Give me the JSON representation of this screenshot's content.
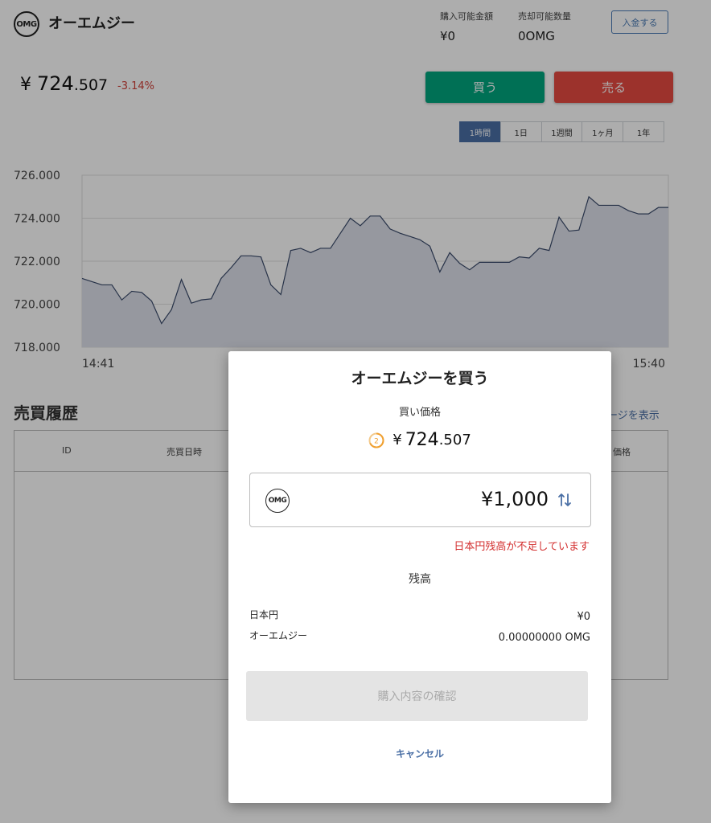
{
  "header": {
    "coin_logo_text": "OMG",
    "coin_name": "オーエムジー",
    "buyable_label": "購入可能金額",
    "buyable_value": "¥0",
    "sellable_label": "売却可能数量",
    "sellable_value": "0OMG",
    "deposit_label": "入金する"
  },
  "price": {
    "currency": "¥",
    "integer": "724",
    "decimal": ".507",
    "change": "-3.14%"
  },
  "actions": {
    "buy_label": "買う",
    "sell_label": "売る"
  },
  "range_tabs": [
    {
      "label": "1時間",
      "active": true
    },
    {
      "label": "1日",
      "active": false
    },
    {
      "label": "1週間",
      "active": false
    },
    {
      "label": "1ヶ月",
      "active": false
    },
    {
      "label": "1年",
      "active": false
    }
  ],
  "chart_data": {
    "type": "area",
    "x_start_label": "14:41",
    "x_end_label": "15:40",
    "y_ticks": [
      "726.000",
      "724.000",
      "722.000",
      "720.000",
      "718.000"
    ],
    "ylim": [
      718,
      726
    ],
    "grid": true,
    "series": [
      {
        "values": [
          721.2,
          721.05,
          720.9,
          720.9,
          720.2,
          720.6,
          720.55,
          720.15,
          719.1,
          719.75,
          721.15,
          720.05,
          720.2,
          720.25,
          721.2,
          721.7,
          722.25,
          722.25,
          722.2,
          720.9,
          720.45,
          722.5,
          722.6,
          722.4,
          722.6,
          722.6,
          723.3,
          724.0,
          723.65,
          724.1,
          724.1,
          723.5,
          723.3,
          723.15,
          723.0,
          722.7,
          721.5,
          722.4,
          721.9,
          721.6,
          721.95,
          721.95,
          721.95,
          721.95,
          722.2,
          722.15,
          722.6,
          722.5,
          724.05,
          723.4,
          723.45,
          725.0,
          724.6,
          724.6,
          724.6,
          724.35,
          724.2,
          724.2,
          724.5,
          724.5
        ],
        "line_color": "#3a4a6b",
        "fill_color": "#dde1ea"
      }
    ]
  },
  "history": {
    "title": "売買履歴",
    "link_text": "ージを表示",
    "col_id": "ID",
    "col_datetime": "売買日時",
    "col_price_partial": "価格"
  },
  "modal": {
    "title": "オーエムジーを買う",
    "price_label": "買い価格",
    "timer_value": "2",
    "price_currency": "¥",
    "price_integer": "724",
    "price_decimal": ".507",
    "amount_logo_text": "OMG",
    "amount_value": "¥1,000",
    "error_text": "日本円残高が不足しています",
    "balance_title": "残高",
    "balance_rows": [
      {
        "label": "日本円",
        "value": "¥0"
      },
      {
        "label": "オーエムジー",
        "value": "0.00000000 OMG"
      }
    ],
    "confirm_label": "購入内容の確認",
    "cancel_label": "キャンセル"
  }
}
